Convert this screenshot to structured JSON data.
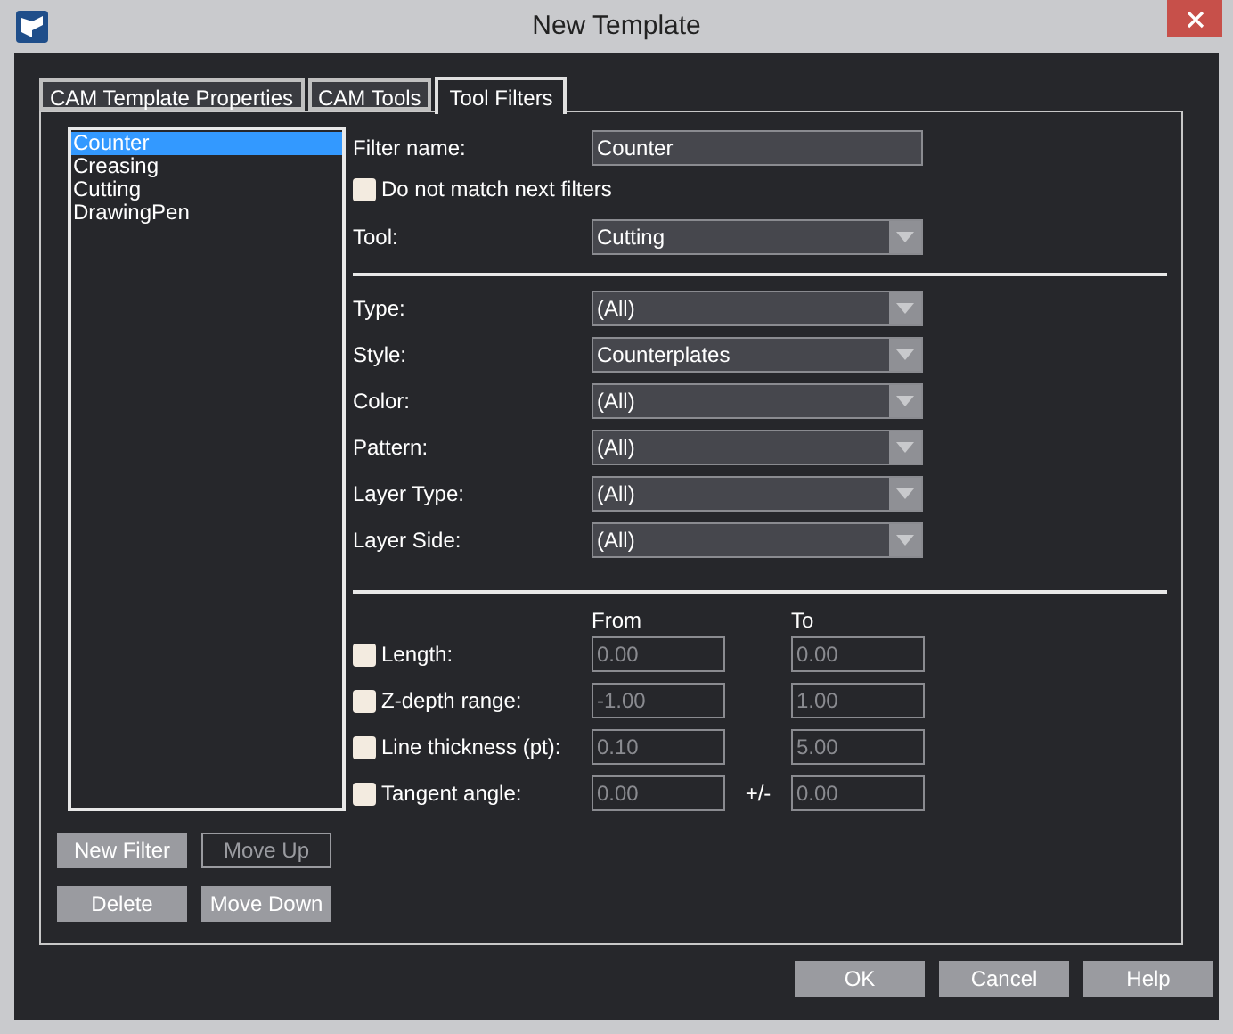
{
  "window": {
    "title": "New Template"
  },
  "tabs": [
    {
      "label": "CAM Template Properties",
      "selected": false
    },
    {
      "label": "CAM Tools",
      "selected": false
    },
    {
      "label": "Tool Filters",
      "selected": true
    }
  ],
  "filter_list": [
    {
      "label": "Counter",
      "selected": true
    },
    {
      "label": "Creasing",
      "selected": false
    },
    {
      "label": "Cutting",
      "selected": false
    },
    {
      "label": "DrawingPen",
      "selected": false
    }
  ],
  "filter_name": {
    "label": "Filter name:",
    "value": "Counter"
  },
  "do_not_match": {
    "label": "Do not match next filters",
    "checked": false
  },
  "tool": {
    "label": "Tool:",
    "value": "Cutting"
  },
  "criteria": [
    {
      "label": "Type:",
      "value": "(All)"
    },
    {
      "label": "Style:",
      "value": "Counterplates"
    },
    {
      "label": "Color:",
      "value": "(All)"
    },
    {
      "label": "Pattern:",
      "value": "(All)"
    },
    {
      "label": "Layer Type:",
      "value": "(All)"
    },
    {
      "label": "Layer Side:",
      "value": "(All)"
    }
  ],
  "ranges": {
    "from_header": "From",
    "to_header": "To",
    "rows": [
      {
        "label": "Length:",
        "checked": false,
        "from": "0.00",
        "to": "0.00",
        "disabled": true
      },
      {
        "label": "Z-depth range:",
        "checked": false,
        "from": "-1.00",
        "to": "1.00",
        "disabled": true
      },
      {
        "label": "Line thickness (pt):",
        "checked": false,
        "from": "0.10",
        "to": "5.00",
        "disabled": true
      },
      {
        "label": "Tangent angle:",
        "checked": false,
        "from": "0.00",
        "to": "0.00",
        "disabled": true,
        "separator": "+/-"
      }
    ]
  },
  "list_buttons": [
    {
      "label": "New Filter",
      "disabled": false
    },
    {
      "label": "Move Up",
      "disabled": true
    },
    {
      "label": "Delete",
      "disabled": false
    },
    {
      "label": "Move Down",
      "disabled": false
    }
  ],
  "dialog_buttons": [
    {
      "label": "OK",
      "disabled": false
    },
    {
      "label": "Cancel",
      "disabled": false
    },
    {
      "label": "Help",
      "disabled": false
    }
  ]
}
